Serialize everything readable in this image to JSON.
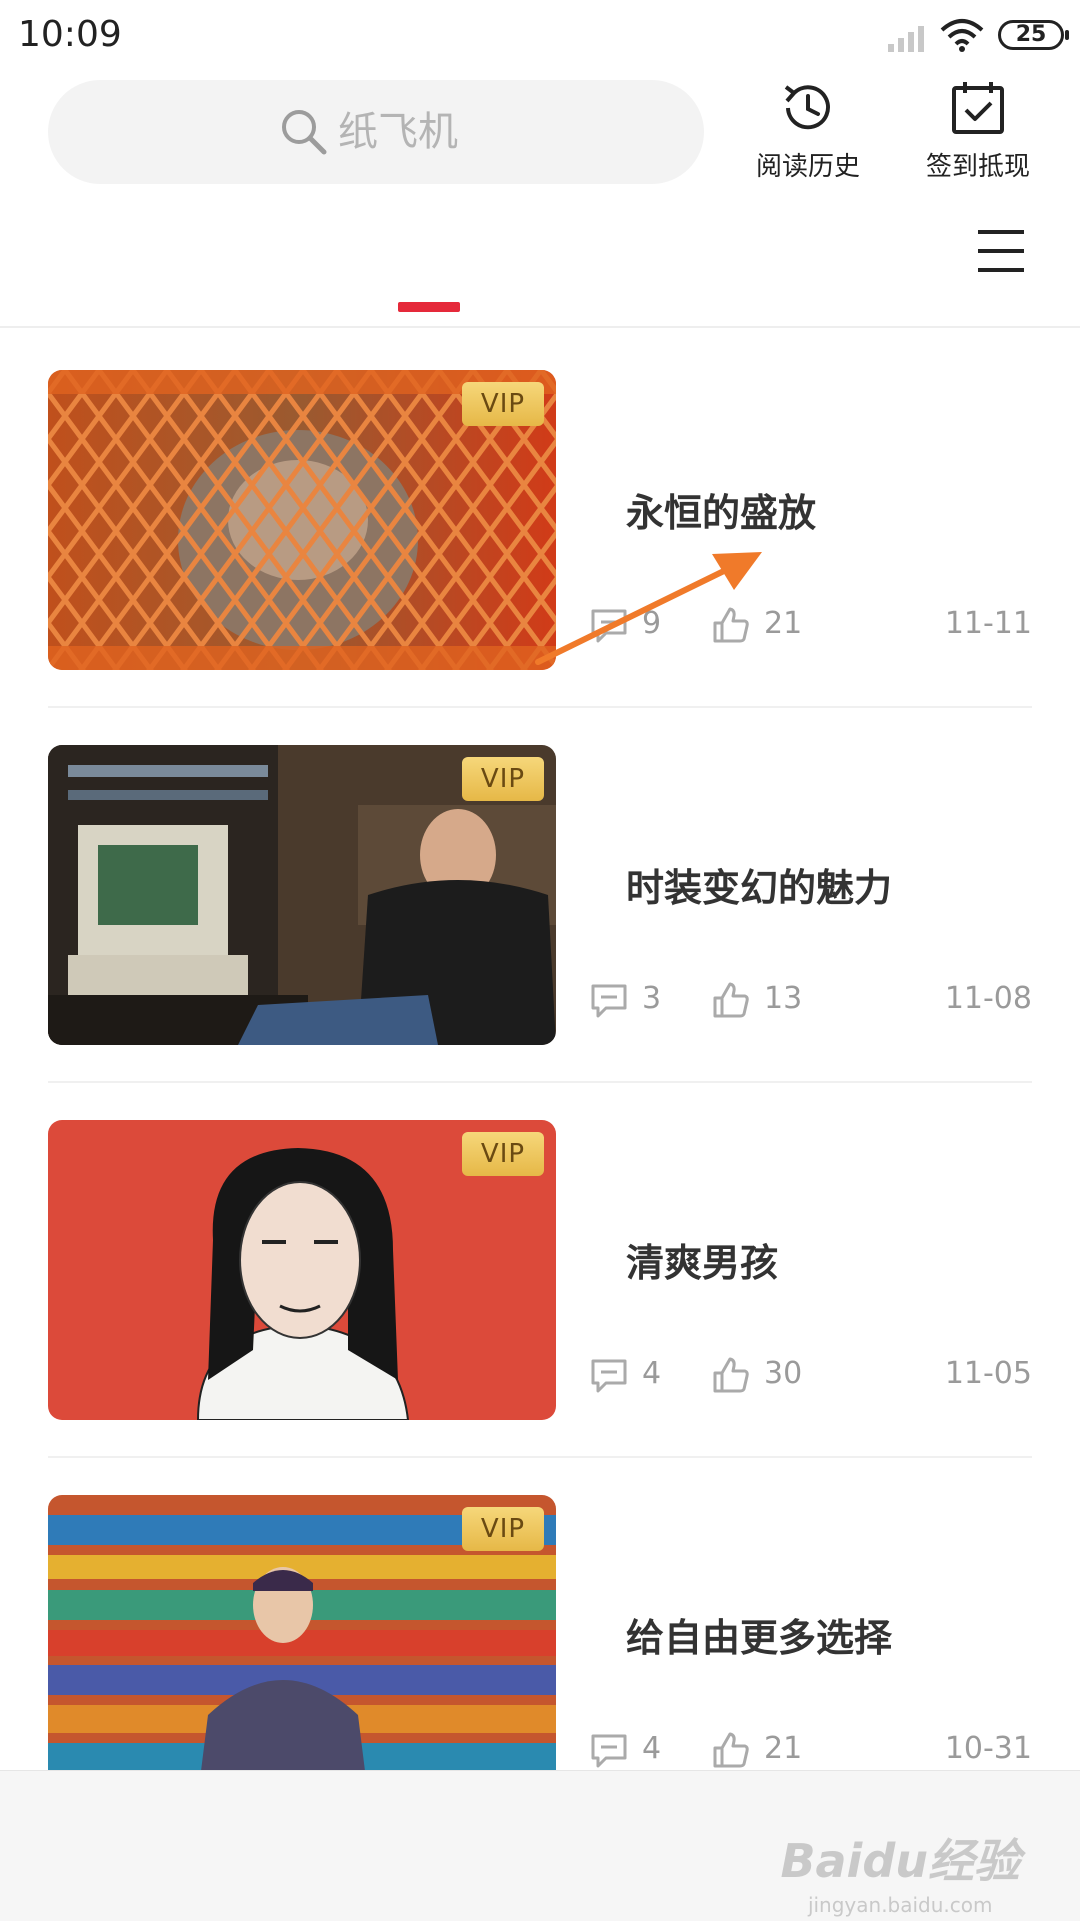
{
  "status_bar": {
    "time": "10:09",
    "battery": "25"
  },
  "search": {
    "placeholder": "纸飞机"
  },
  "header_actions": {
    "history_label": "阅读历史",
    "checkin_label": "签到抵现"
  },
  "vip_badge": "VIP",
  "articles": [
    {
      "title": "永恒的盛放",
      "comments": "9",
      "likes": "21",
      "date": "11-11",
      "thumbnail": "orange-cage-animal"
    },
    {
      "title": "时装变幻的魅力",
      "comments": "3",
      "likes": "13",
      "date": "11-08",
      "thumbnail": "man-desk-computer"
    },
    {
      "title": "清爽男孩",
      "comments": "4",
      "likes": "30",
      "date": "11-05",
      "thumbnail": "woman-portrait-red"
    },
    {
      "title": "给自由更多选择",
      "comments": "4",
      "likes": "21",
      "date": "10-31",
      "thumbnail": "man-colorful-collage"
    }
  ],
  "watermark": {
    "brand": "Baidu经验",
    "url": "jingyan.baidu.com"
  },
  "colors": {
    "accent": "#e5293a",
    "vip_gold": "#e6b847",
    "annotation_arrow": "#f07a2a"
  }
}
